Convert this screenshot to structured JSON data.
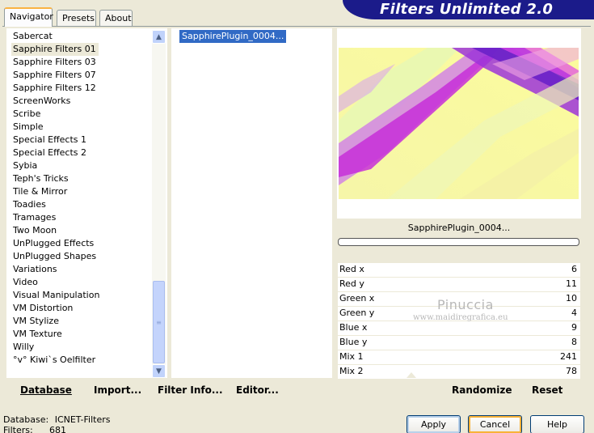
{
  "header": {
    "title": "Filters Unlimited 2.0"
  },
  "tabs": [
    {
      "label": "Navigator",
      "active": true
    },
    {
      "label": "Presets",
      "active": false
    },
    {
      "label": "About",
      "active": false
    }
  ],
  "categories": {
    "selected_index": 1,
    "items": [
      "Sabercat",
      "Sapphire Filters 01",
      "Sapphire Filters 03",
      "Sapphire Filters 07",
      "Sapphire Filters 12",
      "ScreenWorks",
      "Scribe",
      "Simple",
      "Special Effects 1",
      "Special Effects 2",
      "Sybia",
      "Teph's Tricks",
      "Tile & Mirror",
      "Toadies",
      "Tramages",
      "Two Moon",
      "UnPlugged Effects",
      "UnPlugged Shapes",
      "Variations",
      "Video",
      "Visual Manipulation",
      "VM Distortion",
      "VM Stylize",
      "VM Texture",
      "Willy",
      "°v° Kiwi`s Oelfilter"
    ]
  },
  "filters": {
    "items": [
      "SapphirePlugin_0004..."
    ],
    "selected_index": 0
  },
  "preview": {
    "filter_name": "SapphirePlugin_0004..."
  },
  "params": [
    {
      "label": "Red x",
      "value": "6"
    },
    {
      "label": "Red y",
      "value": "11"
    },
    {
      "label": "Green x",
      "value": "10"
    },
    {
      "label": "Green y",
      "value": "4"
    },
    {
      "label": "Blue x",
      "value": "9"
    },
    {
      "label": "Blue y",
      "value": "8"
    },
    {
      "label": "Mix 1",
      "value": "241"
    },
    {
      "label": "Mix 2",
      "value": "78"
    }
  ],
  "watermark": {
    "name": "Pinuccia",
    "site": "www.maidiregrafica.eu"
  },
  "left_buttons": {
    "database": "Database",
    "import": "Import...",
    "filter_info": "Filter Info...",
    "editor": "Editor..."
  },
  "right_buttons": {
    "randomize": "Randomize",
    "reset": "Reset"
  },
  "status": {
    "database_label": "Database:",
    "database_value": "ICNET-Filters",
    "filters_label": "Filters:",
    "filters_value": "681"
  },
  "dialog_buttons": {
    "apply": "Apply",
    "cancel": "Cancel",
    "help": "Help"
  },
  "colors": {
    "title_bg": "#1b1b8a",
    "selection": "#316ac5",
    "dialog_bg": "#ece9d8"
  }
}
